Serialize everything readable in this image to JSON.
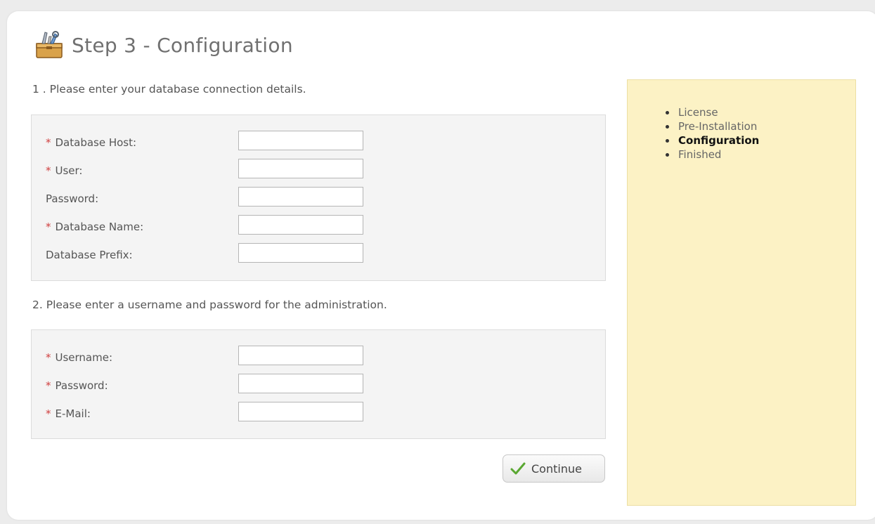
{
  "page_title": "Step 3 - Configuration",
  "section1": {
    "heading": "1 . Please enter your database connection details.",
    "fields": [
      {
        "label": "Database Host:",
        "required": true,
        "value": ""
      },
      {
        "label": "User:",
        "required": true,
        "value": ""
      },
      {
        "label": "Password:",
        "required": false,
        "value": ""
      },
      {
        "label": "Database Name:",
        "required": true,
        "value": ""
      },
      {
        "label": "Database Prefix:",
        "required": false,
        "value": ""
      }
    ]
  },
  "section2": {
    "heading": "2. Please enter a username and password for the administration.",
    "fields": [
      {
        "label": "Username:",
        "required": true,
        "value": ""
      },
      {
        "label": "Password:",
        "required": true,
        "value": ""
      },
      {
        "label": "E-Mail:",
        "required": true,
        "value": ""
      }
    ]
  },
  "required_marker": "*",
  "continue_label": "Continue",
  "steps": [
    {
      "label": "License",
      "active": false
    },
    {
      "label": "Pre-Installation",
      "active": false
    },
    {
      "label": "Configuration",
      "active": true
    },
    {
      "label": "Finished",
      "active": false
    }
  ],
  "colors": {
    "sidebar_bg": "#fcf2c5",
    "required": "#d04040",
    "check_icon": "#5aa832"
  },
  "icons": {
    "header": "toolbox-icon",
    "continue": "checkmark-icon"
  }
}
